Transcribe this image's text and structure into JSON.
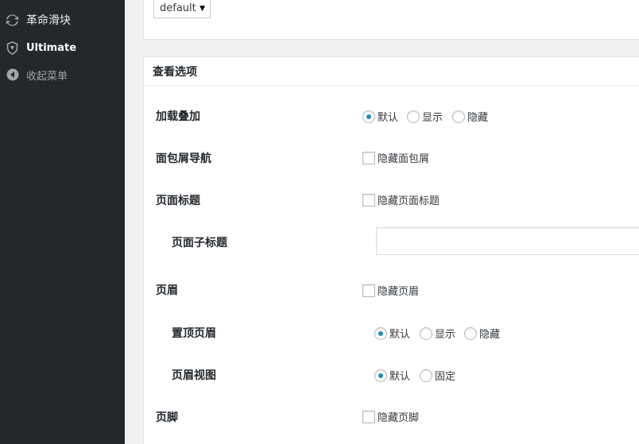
{
  "sidebar": {
    "items": [
      {
        "label": "革命滑块",
        "icon": "refresh-icon"
      },
      {
        "label": "Ultimate",
        "icon": "shield-icon"
      },
      {
        "label": "收起菜单",
        "icon": "collapse-arrow-icon"
      }
    ]
  },
  "top": {
    "select_value": "default"
  },
  "view": {
    "title": "查看选项",
    "rows": [
      {
        "label": "加载叠加",
        "options": [
          "默认",
          "显示",
          "隐藏"
        ],
        "selected": "默认"
      },
      {
        "label": "面包屑导航",
        "checkbox": "隐藏面包屑",
        "checked": false
      },
      {
        "label": "页面标题",
        "checkbox": "隐藏页面标题",
        "checked": false
      },
      {
        "label": "页面子标题",
        "input_value": ""
      },
      {
        "label": "页眉",
        "checkbox": "隐藏页眉",
        "checked": false
      },
      {
        "label": "置顶页眉",
        "options": [
          "默认",
          "显示",
          "隐藏"
        ],
        "selected": "默认"
      },
      {
        "label": "页眉视图",
        "options": [
          "默认",
          "固定"
        ],
        "selected": "默认"
      },
      {
        "label": "页脚",
        "checkbox": "隐藏页脚",
        "checked": false
      }
    ]
  },
  "colors": {
    "sidebar_bg": "#23282d",
    "radio_checked": "#1e8cbe"
  }
}
